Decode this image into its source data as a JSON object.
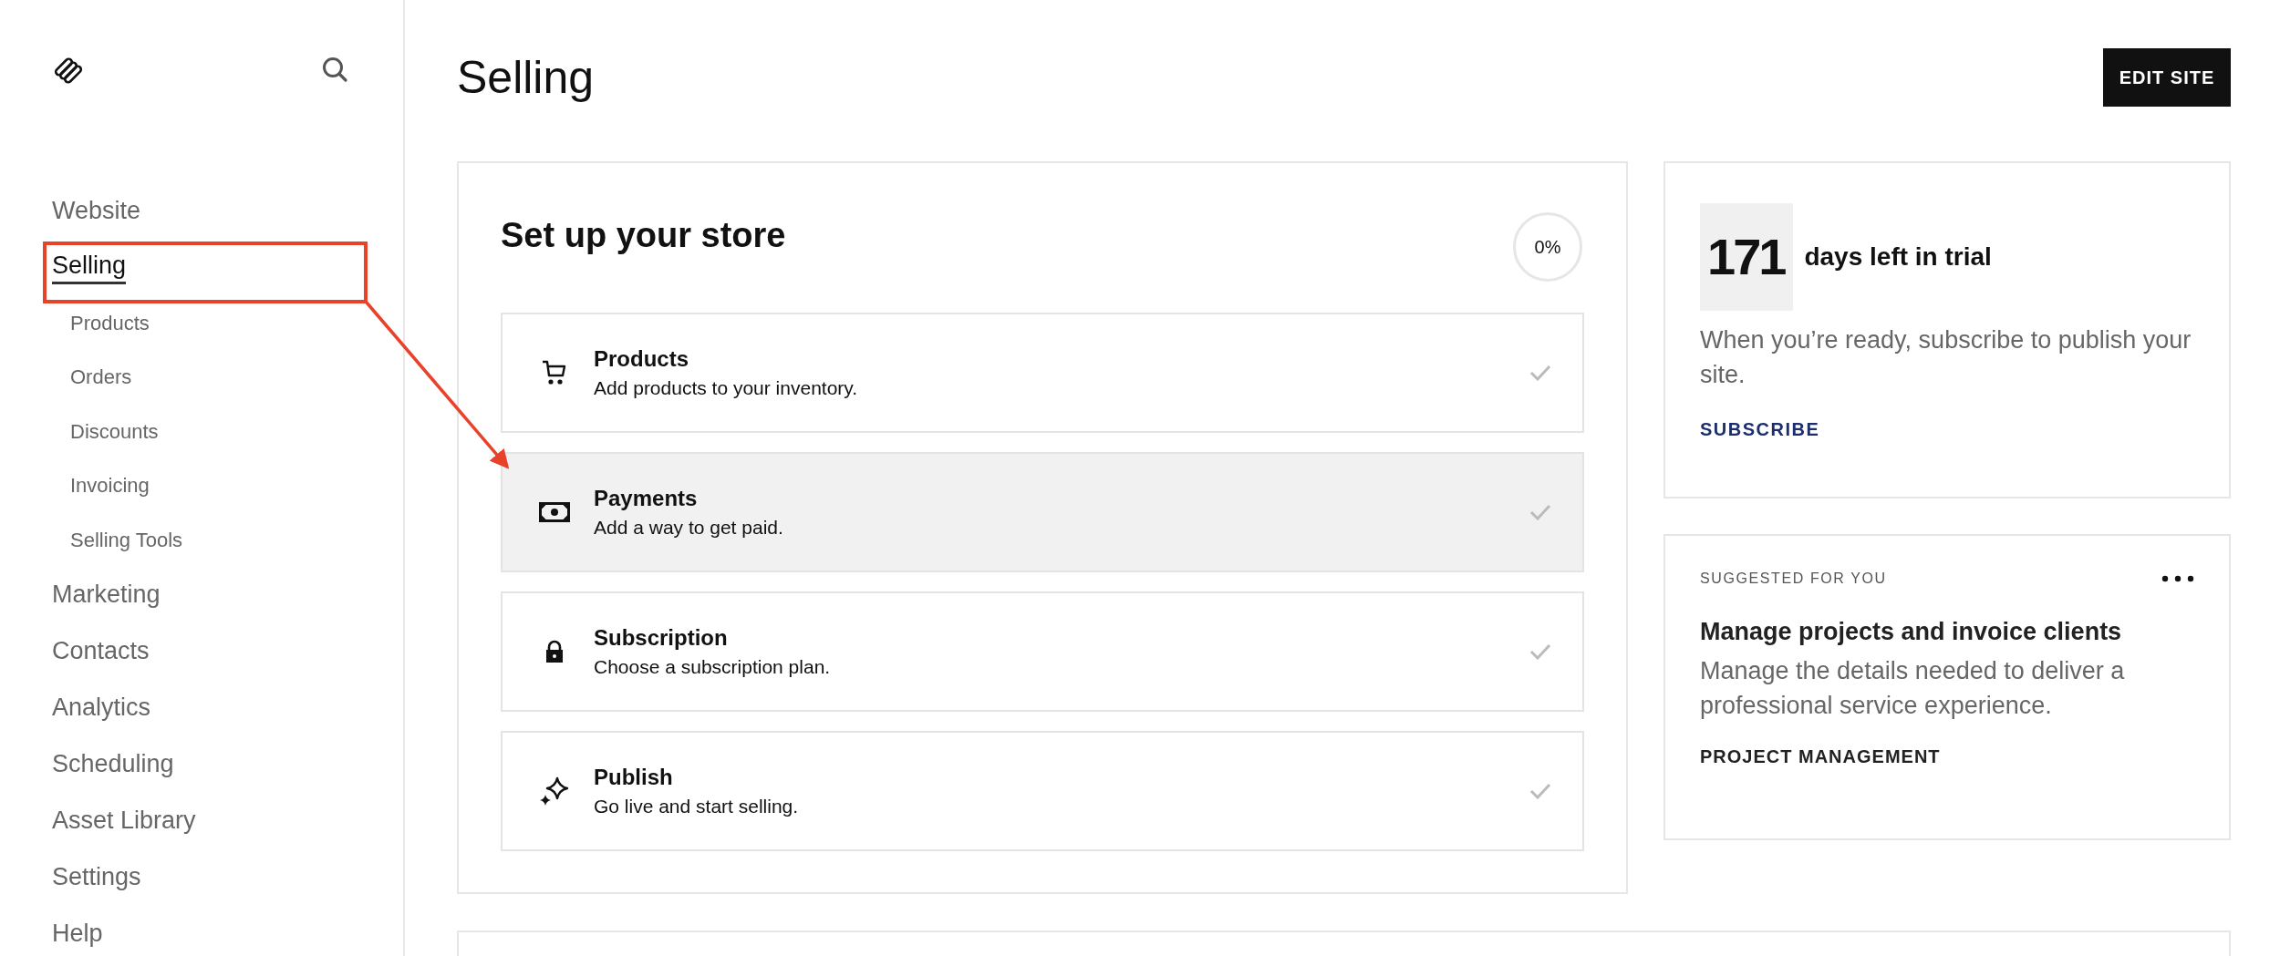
{
  "sidebar": {
    "items": [
      {
        "label": "Website",
        "selected": false
      },
      {
        "label": "Selling",
        "selected": true,
        "children": [
          {
            "label": "Products",
            "selected": false
          },
          {
            "label": "Orders",
            "selected": false
          },
          {
            "label": "Discounts",
            "selected": false
          },
          {
            "label": "Invoicing",
            "selected": false
          },
          {
            "label": "Selling Tools",
            "selected": false
          }
        ]
      },
      {
        "label": "Marketing",
        "selected": false
      },
      {
        "label": "Contacts",
        "selected": false
      },
      {
        "label": "Analytics",
        "selected": false
      },
      {
        "label": "Scheduling",
        "selected": false
      },
      {
        "label": "Asset Library",
        "selected": false
      },
      {
        "label": "Settings",
        "selected": false
      },
      {
        "label": "Help",
        "selected": false
      }
    ]
  },
  "header": {
    "title": "Selling",
    "edit_button": "EDIT SITE"
  },
  "setup_card": {
    "title": "Set up your store",
    "progress": "0%",
    "steps": [
      {
        "title": "Products",
        "description": "Add products to your inventory.",
        "selected": false
      },
      {
        "title": "Payments",
        "description": "Add a way to get paid.",
        "selected": true
      },
      {
        "title": "Subscription",
        "description": "Choose a subscription plan.",
        "selected": false
      },
      {
        "title": "Publish",
        "description": "Go live and start selling.",
        "selected": false
      }
    ]
  },
  "trial_card": {
    "days": "171",
    "label": "days left in trial",
    "text": "When you’re ready, subscribe to publish your site.",
    "link": "SUBSCRIBE"
  },
  "suggestion_card": {
    "eyebrow": "SUGGESTED FOR YOU",
    "title": "Manage projects and invoice clients",
    "text": "Manage the details needed to deliver a professional service experience.",
    "link": "PROJECT MANAGEMENT"
  }
}
